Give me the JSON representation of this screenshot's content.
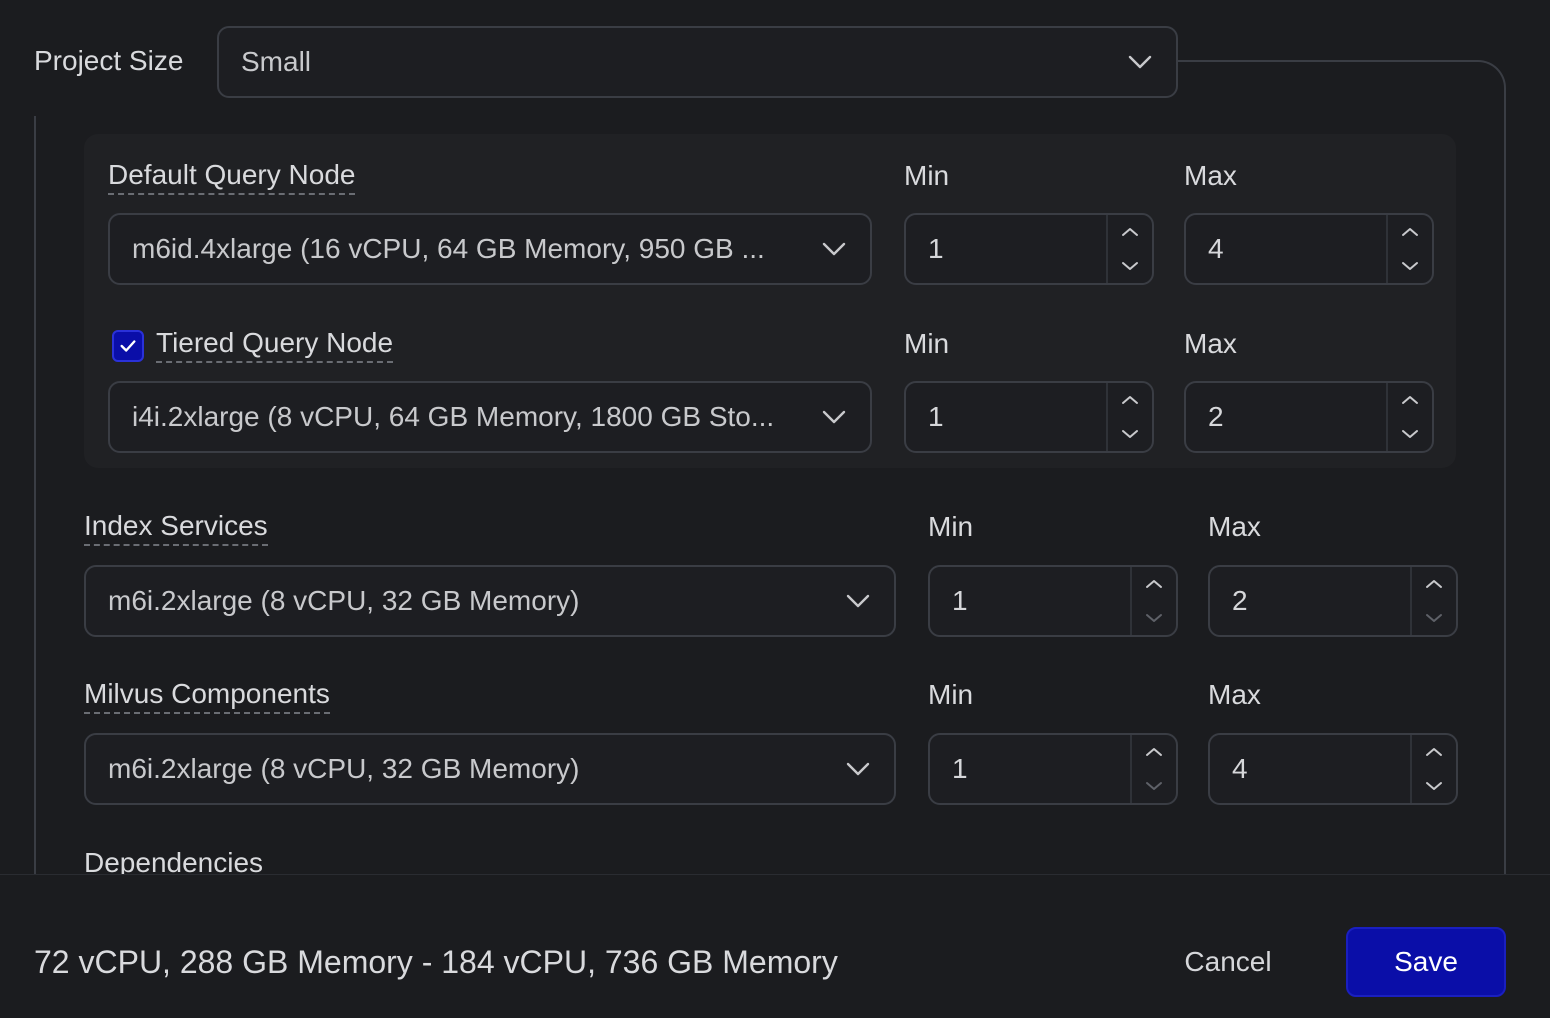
{
  "project_size": {
    "label": "Project Size",
    "value": "Small"
  },
  "query_nodes": {
    "default": {
      "label": "Default Query Node",
      "instance": "m6id.4xlarge (16 vCPU, 64 GB Memory, 950 GB ...",
      "min_label": "Min",
      "max_label": "Max",
      "min": "1",
      "max": "4"
    },
    "tiered": {
      "label": "Tiered Query Node",
      "checked": true,
      "instance": "i4i.2xlarge (8 vCPU, 64 GB Memory, 1800 GB Sto...",
      "min_label": "Min",
      "max_label": "Max",
      "min": "1",
      "max": "2"
    }
  },
  "index_services": {
    "label": "Index Services",
    "instance": "m6i.2xlarge (8 vCPU, 32 GB Memory)",
    "min_label": "Min",
    "max_label": "Max",
    "min": "1",
    "max": "2"
  },
  "milvus_components": {
    "label": "Milvus Components",
    "instance": "m6i.2xlarge (8 vCPU, 32 GB Memory)",
    "min_label": "Min",
    "max_label": "Max",
    "min": "1",
    "max": "4"
  },
  "dependencies": {
    "label": "Dependencies"
  },
  "footer": {
    "summary": "72 vCPU, 288 GB Memory - 184 vCPU, 736 GB Memory",
    "cancel_label": "Cancel",
    "save_label": "Save"
  },
  "icons": {
    "dropdown": "chevron-down-icon",
    "increment": "chevron-up-icon",
    "decrement": "chevron-down-icon",
    "check": "check-icon"
  },
  "colors": {
    "background": "#1b1c1f",
    "accent": "#0a0ea8",
    "border": "#3a3d44",
    "text": "#d6d7da"
  }
}
